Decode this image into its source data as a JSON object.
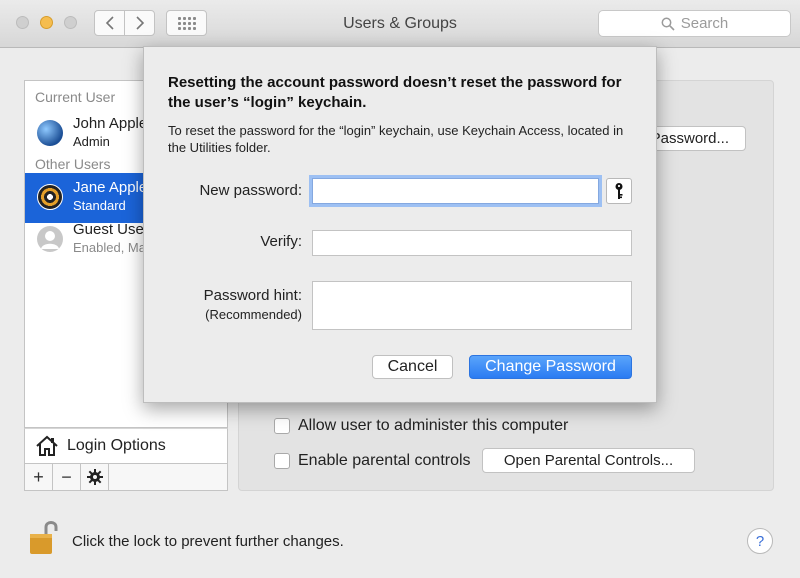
{
  "window": {
    "title": "Users & Groups",
    "search_placeholder": "Search"
  },
  "sidebar": {
    "current_user_label": "Current User",
    "other_users_label": "Other Users",
    "users": [
      {
        "name": "John Apple",
        "role": "Admin",
        "avatar": "globe-avatar"
      },
      {
        "name": "Jane Apple",
        "role": "Standard",
        "avatar": "target-avatar",
        "selected": true
      },
      {
        "name": "Guest User",
        "role": "Enabled, Managed",
        "avatar": "guest-avatar"
      }
    ],
    "login_options": "Login Options",
    "toolbar": {
      "add": "+",
      "remove": "−",
      "actions": "gear-icon"
    }
  },
  "pane": {
    "reset_password_button": "Reset Password...",
    "allow_admin": "Allow user to administer this computer",
    "parental_controls": "Enable parental controls",
    "open_parental_button": "Open Parental Controls..."
  },
  "footer": {
    "lock_text": "Click the lock to prevent further changes.",
    "help": "?"
  },
  "sheet": {
    "title": "Resetting the account password doesn’t reset the password for the user’s “login” keychain.",
    "message": "To reset the password for the “login” keychain, use Keychain Access, located in the Utilities folder.",
    "new_password_label": "New password:",
    "new_password_value": "",
    "verify_label": "Verify:",
    "verify_value": "",
    "hint_label": "Password hint:",
    "hint_sub": "(Recommended)",
    "hint_value": "",
    "cancel_button": "Cancel",
    "change_button": "Change Password"
  },
  "colors": {
    "selection": "#1b64d9",
    "default_button": "#2a7bf2",
    "focus_ring": "#9dc0f3"
  }
}
